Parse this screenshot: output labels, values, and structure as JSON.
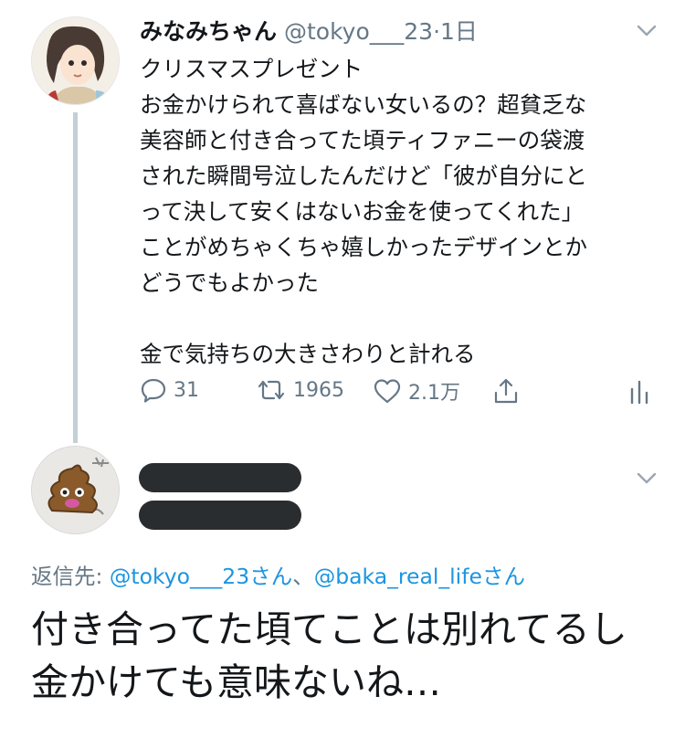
{
  "tweet": {
    "display_name": "みなみちゃん",
    "handle": "@tokyo___23",
    "separator": "·",
    "time": "1日",
    "text": "クリスマスプレゼント\nお金かけられて喜ばない女いるの？超貧乏な\n美容師と付き合ってた頃ティファニーの袋渡\nされた瞬間号泣したんだけど「彼が自分にと\nって決して安くはないお金を使ってくれた」\nことがめちゃくちゃ嬉しかったデザインとか\nどうでもよかった\n\n金で気持ちの大きさわりと計れる",
    "replies": "31",
    "retweets": "1965",
    "likes": "2.1万"
  },
  "reply": {
    "reply_to_label": "返信先: ",
    "mention1": "@tokyo___23さん",
    "separator": "、",
    "mention2": "@baka_real_lifeさん",
    "text": "付き合ってた頃てことは別れてるし金かけても意味ないね…"
  },
  "icons": [
    "chevron-down-icon",
    "reply-icon",
    "retweet-icon",
    "like-icon",
    "share-icon",
    "analytics-icon"
  ],
  "colors": {
    "text": "#14171a",
    "muted": "#657786",
    "link": "#1b95e0",
    "thread_line": "#c4cfd6"
  }
}
